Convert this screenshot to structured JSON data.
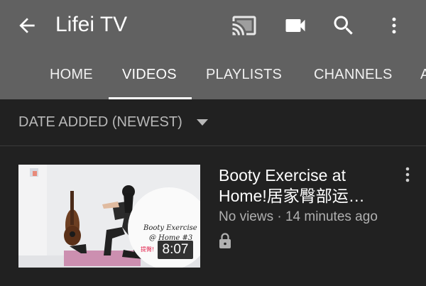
{
  "header": {
    "channel_title": "Lifei TV",
    "icons": [
      "back-arrow-icon",
      "cast-icon",
      "video-camera-icon",
      "search-icon",
      "more-vert-icon"
    ]
  },
  "tabs": [
    {
      "label": "HOME",
      "selected": false
    },
    {
      "label": "VIDEOS",
      "selected": true
    },
    {
      "label": "PLAYLISTS",
      "selected": false
    },
    {
      "label": "CHANNELS",
      "selected": false
    },
    {
      "label": "A",
      "selected": false
    }
  ],
  "sort": {
    "label": "DATE ADDED (NEWEST)"
  },
  "videos": [
    {
      "title_line1": "Booty Exercise at",
      "title_line2": "Home!居家臀部运…",
      "meta": "No views · 14 minutes ago",
      "duration": "8:07",
      "thumbnail_text_line1": "Booty Exercise",
      "thumbnail_text_line2": "@ Home #3",
      "thumbnail_badge": "提臀!",
      "privacy": "lock-icon"
    }
  ],
  "colors": {
    "appbar": "#616161",
    "background": "#212121",
    "text_primary": "#ffffff",
    "text_secondary": "#b0b0b0"
  }
}
